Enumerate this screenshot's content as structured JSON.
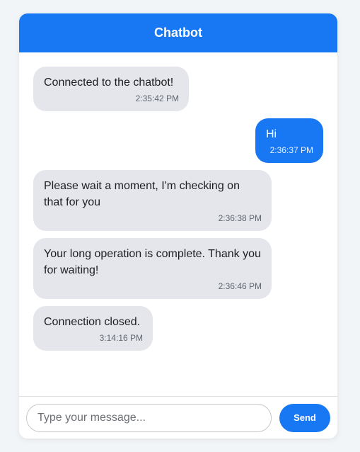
{
  "header": {
    "title": "Chatbot"
  },
  "messages": [
    {
      "sender": "bot",
      "text": "Connected to the chatbot!",
      "time": "2:35:42 PM"
    },
    {
      "sender": "user",
      "text": "Hi",
      "time": "2:36:37 PM"
    },
    {
      "sender": "bot",
      "text": "Please wait a moment, I'm checking on that for you",
      "time": "2:36:38 PM"
    },
    {
      "sender": "bot",
      "text": "Your long operation is complete. Thank you for waiting!",
      "time": "2:36:46 PM"
    },
    {
      "sender": "bot",
      "text": "Connection closed.",
      "time": "3:14:16 PM"
    }
  ],
  "composer": {
    "placeholder": "Type your message...",
    "value": "",
    "send_label": "Send"
  },
  "colors": {
    "accent": "#1877f2",
    "bot_bubble": "#e4e6eb",
    "background": "#f2f5f8"
  }
}
